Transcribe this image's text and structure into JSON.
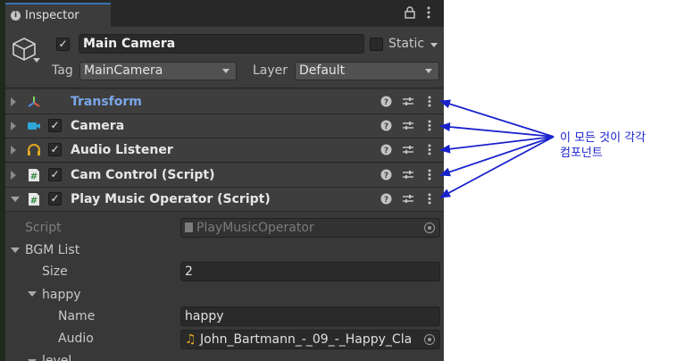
{
  "tab": {
    "title": "Inspector"
  },
  "object": {
    "name": "Main Camera",
    "static_label": "Static",
    "tag_label": "Tag",
    "tag_value": "MainCamera",
    "layer_label": "Layer",
    "layer_value": "Default"
  },
  "components": [
    {
      "label": "Transform",
      "icon": "transform-icon"
    },
    {
      "label": "Camera",
      "icon": "camera-icon"
    },
    {
      "label": "Audio Listener",
      "icon": "headphones-icon"
    },
    {
      "label": "Cam Control (Script)",
      "icon": "script-icon"
    },
    {
      "label": "Play Music Operator (Script)",
      "icon": "script-icon"
    }
  ],
  "fields": {
    "script_label": "Script",
    "script_value": "PlayMusicOperator",
    "bgm_list_label": "BGM List",
    "size_label": "Size",
    "size_value": "2",
    "element_label": "happy",
    "name_label": "Name",
    "name_value": "happy",
    "audio_label": "Audio",
    "audio_value": "John_Bartmann_-_09_-_Happy_Cla",
    "next_label": "level"
  },
  "annotation": {
    "text": "이 모든 것이 각각\n컴포넌트"
  },
  "colors": {
    "panel": "#383838",
    "accent_blue": "#7aa6e8",
    "annotation": "#1a22cc"
  }
}
